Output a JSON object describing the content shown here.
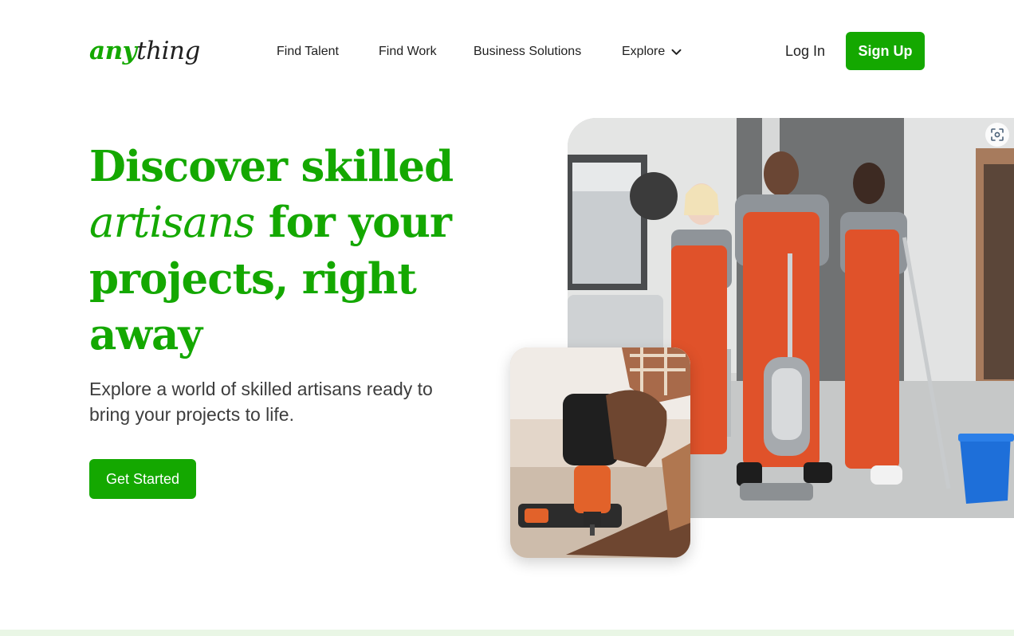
{
  "brand": {
    "logo_prefix": "any",
    "logo_suffix": "thing",
    "accent": "#14a800"
  },
  "nav": {
    "items": [
      {
        "label": "Find Talent"
      },
      {
        "label": "Find Work"
      },
      {
        "label": "Business Solutions"
      },
      {
        "label": "Explore",
        "icon": "chevron-down-icon"
      }
    ]
  },
  "auth": {
    "login_label": "Log In",
    "signup_label": "Sign Up"
  },
  "hero": {
    "title_line1": "Discover skilled",
    "title_em": "artisans",
    "title_line2_rest": " for your",
    "title_line3": "projects, right",
    "title_line4": "away",
    "subtitle": "Explore a world of skilled artisans ready to bring your projects to life.",
    "cta_label": "Get Started"
  },
  "images": {
    "main_icon": "scan-icon",
    "colors": {
      "overalls": "#e0522a",
      "shirt": "#8f9499",
      "bucket": "#1e6fd9"
    }
  }
}
